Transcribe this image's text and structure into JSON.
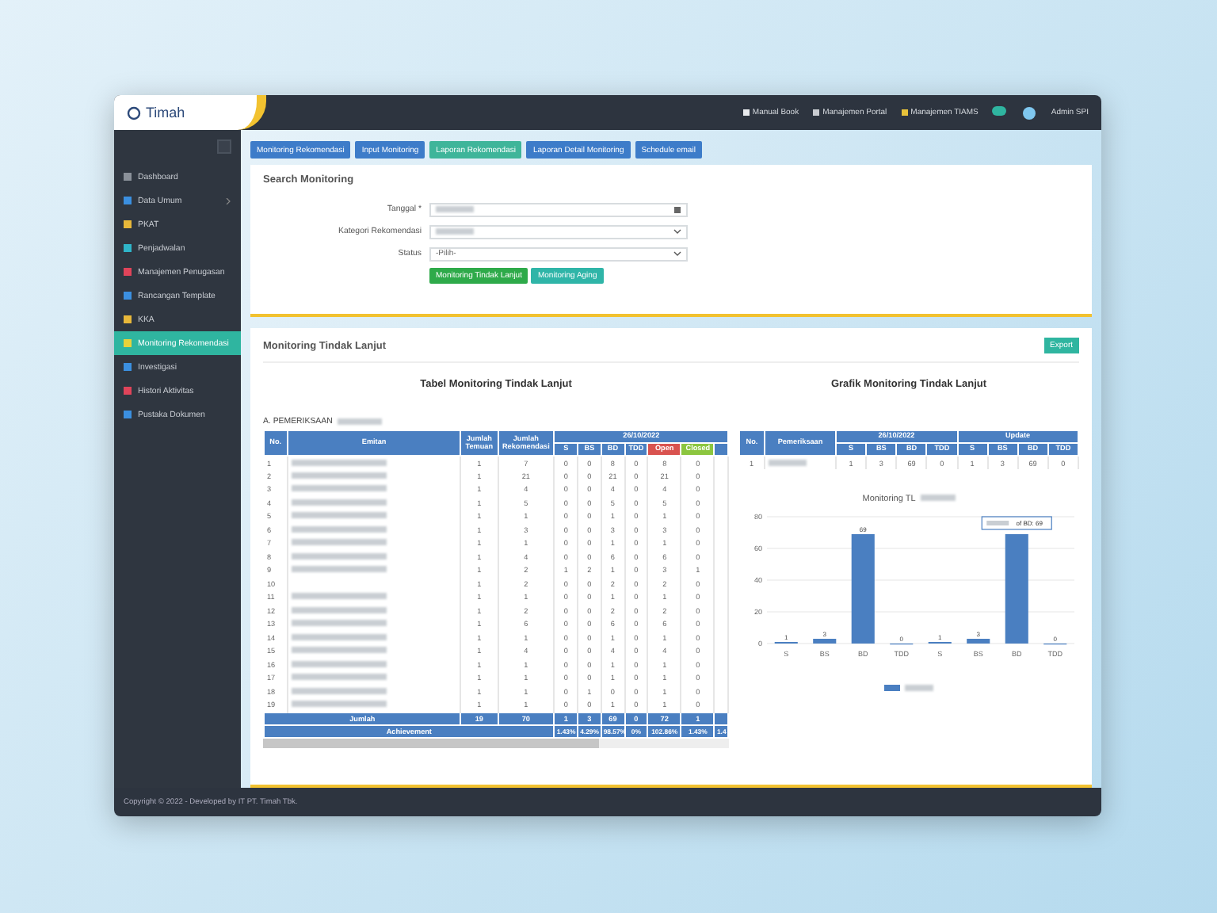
{
  "top_bar": {
    "logo": "Timah",
    "links": [
      {
        "label": "Manual Book",
        "color": "#e8eaed"
      },
      {
        "label": "Manajemen Portal",
        "color": "#c9ccd1"
      },
      {
        "label": "Manajemen TIAMS",
        "color": "#e8c23a"
      }
    ],
    "user": "Admin SPI"
  },
  "sidebar": {
    "items": [
      {
        "label": "Dashboard",
        "selected": false,
        "expandable": false,
        "color": "#8a9099"
      },
      {
        "label": "Data Umum",
        "selected": false,
        "expandable": true,
        "color": "#3b8fe0"
      },
      {
        "label": "PKAT",
        "selected": false,
        "expandable": false,
        "color": "#e8b83a"
      },
      {
        "label": "Penjadwalan",
        "selected": false,
        "expandable": false,
        "color": "#2fb5c9"
      },
      {
        "label": "Manajemen Penugasan",
        "selected": false,
        "expandable": false,
        "color": "#e0445a"
      },
      {
        "label": "Rancangan Template",
        "selected": false,
        "expandable": false,
        "color": "#3b8fe0"
      },
      {
        "label": "KKA",
        "selected": false,
        "expandable": false,
        "color": "#e8b83a"
      },
      {
        "label": "Monitoring Rekomendasi",
        "selected": true,
        "expandable": false,
        "color": "#e8d23a"
      },
      {
        "label": "Investigasi",
        "selected": false,
        "expandable": false,
        "color": "#3b8fe0"
      },
      {
        "label": "Histori Aktivitas",
        "selected": false,
        "expandable": false,
        "color": "#e0445a"
      },
      {
        "label": "Pustaka Dokumen",
        "selected": false,
        "expandable": false,
        "color": "#3b8fe0"
      }
    ]
  },
  "nav_buttons": [
    {
      "label": "Monitoring Rekomendasi",
      "color": "#3d7cc9"
    },
    {
      "label": "Input Monitoring",
      "color": "#3d7cc9"
    },
    {
      "label": "Laporan Rekomendasi",
      "color": "#3fb59a"
    },
    {
      "label": "Laporan Detail Monitoring",
      "color": "#3d7cc9"
    },
    {
      "label": "Schedule email",
      "color": "#3d7cc9"
    }
  ],
  "search_card": {
    "title": "Search Monitoring",
    "fields": [
      {
        "label": "Tanggal *",
        "kind": "date"
      },
      {
        "label": "Kategori Rekomendasi",
        "kind": "select"
      },
      {
        "label": "Status",
        "kind": "select",
        "value": "-Pilih-"
      }
    ],
    "buttons": [
      {
        "label": "Monitoring Tindak Lanjut",
        "color": "#2eaa4a"
      },
      {
        "label": "Monitoring Aging",
        "color": "#2fb5a8"
      }
    ]
  },
  "monitoring_card": {
    "title": "Monitoring Tindak Lanjut",
    "export_button": "Export",
    "table_title": "Tabel Monitoring Tindak Lanjut",
    "chart_title": "Grafik Monitoring Tindak Lanjut",
    "section": "A. PEMERIKSAAN",
    "left_table": {
      "columns": [
        "No.",
        "Emitan",
        "Jumlah Temuan",
        "Jumlah Rekomendasi"
      ],
      "date_header": "26/10/2022",
      "sub_columns": [
        {
          "label": "S",
          "color": "#4a7fc1"
        },
        {
          "label": "BS",
          "color": "#4a7fc1"
        },
        {
          "label": "BD",
          "color": "#4a7fc1"
        },
        {
          "label": "TDD",
          "color": "#4a7fc1"
        },
        {
          "label": "Open",
          "color": "#d9534f"
        },
        {
          "label": "Closed",
          "color": "#8cc63f"
        }
      ],
      "rows": [
        {
          "no": "1",
          "redacted": true,
          "values": [
            "1",
            "7",
            "0",
            "0",
            "8",
            "0",
            "8",
            "0"
          ]
        },
        {
          "no": "2",
          "redacted": true,
          "values": [
            "1",
            "21",
            "0",
            "0",
            "21",
            "0",
            "21",
            "0"
          ]
        },
        {
          "no": "3",
          "redacted": true,
          "values": [
            "1",
            "4",
            "0",
            "0",
            "4",
            "0",
            "4",
            "0"
          ]
        },
        {
          "no": "4",
          "redacted": true,
          "values": [
            "1",
            "5",
            "0",
            "0",
            "5",
            "0",
            "5",
            "0"
          ]
        },
        {
          "no": "5",
          "redacted": true,
          "values": [
            "1",
            "1",
            "0",
            "0",
            "1",
            "0",
            "1",
            "0"
          ]
        },
        {
          "no": "6",
          "redacted": true,
          "values": [
            "1",
            "3",
            "0",
            "0",
            "3",
            "0",
            "3",
            "0"
          ]
        },
        {
          "no": "7",
          "redacted": true,
          "values": [
            "1",
            "1",
            "0",
            "0",
            "1",
            "0",
            "1",
            "0"
          ]
        },
        {
          "no": "8",
          "redacted": true,
          "values": [
            "1",
            "4",
            "0",
            "0",
            "6",
            "0",
            "6",
            "0"
          ]
        },
        {
          "no": "9",
          "redacted": true,
          "values": [
            "1",
            "2",
            "1",
            "2",
            "1",
            "0",
            "3",
            "1"
          ]
        },
        {
          "no": "10",
          "redacted": false,
          "values": [
            "1",
            "2",
            "0",
            "0",
            "2",
            "0",
            "2",
            "0"
          ]
        },
        {
          "no": "11",
          "redacted": true,
          "values": [
            "1",
            "1",
            "0",
            "0",
            "1",
            "0",
            "1",
            "0"
          ]
        },
        {
          "no": "12",
          "redacted": true,
          "values": [
            "1",
            "2",
            "0",
            "0",
            "2",
            "0",
            "2",
            "0"
          ]
        },
        {
          "no": "13",
          "redacted": true,
          "values": [
            "1",
            "6",
            "0",
            "0",
            "6",
            "0",
            "6",
            "0"
          ]
        },
        {
          "no": "14",
          "redacted": true,
          "values": [
            "1",
            "1",
            "0",
            "0",
            "1",
            "0",
            "1",
            "0"
          ]
        },
        {
          "no": "15",
          "redacted": true,
          "values": [
            "1",
            "4",
            "0",
            "0",
            "4",
            "0",
            "4",
            "0"
          ]
        },
        {
          "no": "16",
          "redacted": true,
          "values": [
            "1",
            "1",
            "0",
            "0",
            "1",
            "0",
            "1",
            "0"
          ]
        },
        {
          "no": "17",
          "redacted": true,
          "values": [
            "1",
            "1",
            "0",
            "0",
            "1",
            "0",
            "1",
            "0"
          ]
        },
        {
          "no": "18",
          "redacted": true,
          "values": [
            "1",
            "1",
            "0",
            "1",
            "0",
            "0",
            "1",
            "0"
          ]
        },
        {
          "no": "19",
          "redacted": true,
          "values": [
            "1",
            "1",
            "0",
            "0",
            "1",
            "0",
            "1",
            "0"
          ]
        }
      ],
      "total": {
        "label": "Jumlah",
        "values": [
          "19",
          "70",
          "1",
          "3",
          "69",
          "0",
          "72",
          "1"
        ]
      },
      "achievement": {
        "label": "Achievement",
        "values": [
          "1.43%",
          "4.29%",
          "98.57%",
          "0%",
          "102.86%",
          "1.43%",
          "1.4"
        ]
      }
    },
    "right_table": {
      "columns": [
        "No.",
        "Pemeriksaan"
      ],
      "groups": [
        {
          "label": "26/10/2022",
          "sub": [
            "S",
            "BS",
            "BD",
            "TDD"
          ]
        },
        {
          "label": "Update",
          "sub": [
            "S",
            "BS",
            "BD",
            "TDD"
          ]
        }
      ],
      "rows": [
        {
          "no": "1",
          "values": [
            "1",
            "3",
            "69",
            "0",
            "1",
            "3",
            "69",
            "0"
          ]
        }
      ]
    },
    "chart_data": {
      "type": "bar",
      "title": "Monitoring TL",
      "categories": [
        "S",
        "BS",
        "BD",
        "TDD",
        "S",
        "BS",
        "BD",
        "TDD"
      ],
      "ylim": [
        0,
        80
      ],
      "yticks": [
        0,
        20,
        40,
        60,
        80
      ],
      "value_labels": [
        "1",
        "3",
        "69",
        "0",
        "1",
        "3",
        null,
        "0"
      ],
      "series": [
        {
          "color": "#4a7fc1",
          "values": [
            1,
            3,
            69,
            0,
            1,
            3,
            69,
            0
          ]
        }
      ],
      "grid": true,
      "annotations": [
        {
          "text": "of BD: 69",
          "y": 69
        }
      ]
    }
  },
  "footer": "Copyright © 2022 - Developed by IT PT. Timah Tbk."
}
